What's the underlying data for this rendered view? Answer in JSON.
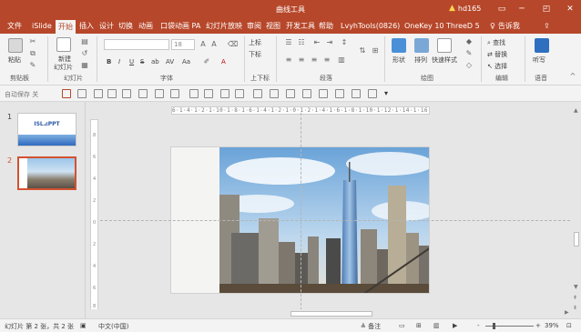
{
  "window": {
    "title": "曲线工具",
    "user": "hd165",
    "warning_icon": "warning-icon",
    "controls": [
      "minimize-icon",
      "restore-icon",
      "close-icon"
    ],
    "restore_glyph": "◰",
    "ribbon_display_glyph": "▭"
  },
  "colors": {
    "brand": "#b7472a",
    "accent": "#d35230",
    "ribbon_bg": "#f3f3f3",
    "canvas_bg": "#e6e6e6"
  },
  "ribbon_tabs": [
    {
      "label": "文件"
    },
    {
      "label": "iSlide"
    },
    {
      "label": "开始",
      "active": true
    },
    {
      "label": "插入"
    },
    {
      "label": "设计"
    },
    {
      "label": "切换"
    },
    {
      "label": "动画"
    },
    {
      "label": "口袋动画 PA"
    },
    {
      "label": "幻灯片放映"
    },
    {
      "label": "审阅"
    },
    {
      "label": "视图"
    },
    {
      "label": "开发工具"
    },
    {
      "label": "帮助"
    },
    {
      "label": "LvyhTools(0826)"
    },
    {
      "label": "OneKey 10"
    },
    {
      "label": "ThreeD 5"
    }
  ],
  "tell_me": "告诉我",
  "ribbon": {
    "clipboard": {
      "label": "剪贴板",
      "paste": "粘贴"
    },
    "slides": {
      "label": "幻灯片",
      "new_slide": "新建",
      "new_slide2": "幻灯片"
    },
    "font": {
      "label": "字体",
      "size": "18",
      "buttons": [
        "B",
        "I",
        "U",
        "S",
        "ab",
        "AV",
        "Aa",
        "A"
      ]
    },
    "script": {
      "label": "上下标",
      "superscript": "上标",
      "subscript": "下标"
    },
    "paragraph": {
      "label": "段落"
    },
    "drawing": {
      "label": "绘图",
      "shapes": "形状",
      "arrange": "排列",
      "quick_styles": "快速样式"
    },
    "editing": {
      "label": "编辑",
      "find": "查找",
      "replace": "替换",
      "select": "选择"
    },
    "voice": {
      "label": "语音",
      "dictate": "听写"
    }
  },
  "qat": {
    "autosave": "自动保存",
    "autosave_state": "关"
  },
  "ruler_h_text": "6·1·4·1·2·1·10·1·8·1·6·1·4·1·2·1·0·1·2·1·4·1·6·1·8·1·10·1·12·1·14·1·16",
  "ruler_v_marks": [
    "8",
    "6",
    "4",
    "2",
    "0",
    "2",
    "4",
    "6",
    "8"
  ],
  "thumbnails": [
    {
      "number": "1",
      "caption": "ISL⊿PPT"
    },
    {
      "number": "2",
      "caption": ""
    }
  ],
  "status": {
    "slide_info": "幻灯片 第 2 张，共 2 张",
    "language": "中文(中国)",
    "notes": "备注",
    "zoom_minus": "-",
    "zoom_plus": "+",
    "zoom": "39%",
    "zoom_level": 0.39
  }
}
